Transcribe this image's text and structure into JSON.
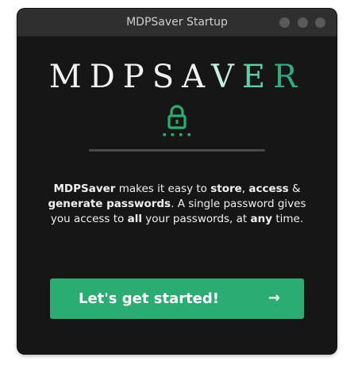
{
  "window": {
    "title": "MDPSaver Startup"
  },
  "logo": {
    "text": "MDPSAVER",
    "letters": [
      "M",
      "D",
      "P",
      "S",
      "A",
      "V",
      "E",
      "R"
    ]
  },
  "description": {
    "app": "MDPSaver",
    "t1": " makes it easy to ",
    "store": "store",
    "t2": ", ",
    "access": "access",
    "t3": " & ",
    "generate": "generate passwords",
    "t4": ". A single password gives you access to ",
    "all": "all",
    "t5": " your passwords, at ",
    "any": "any",
    "t6": " time."
  },
  "button": {
    "label": "Let's get started!",
    "arrow": "→"
  },
  "colors": {
    "accent": "#2bac72",
    "background": "#161616",
    "titlebar": "#2f2f2f"
  },
  "icons": {
    "lock": "lock-icon",
    "arrow": "arrow-right-icon"
  }
}
